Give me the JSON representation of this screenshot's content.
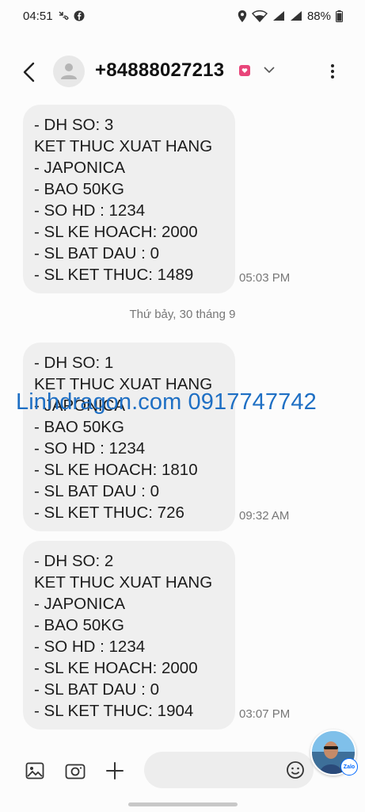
{
  "status_bar": {
    "time": "04:51",
    "battery": "88%"
  },
  "header": {
    "contact": "+84888027213"
  },
  "messages": [
    {
      "lines": [
        "- DH SO: 3",
        "KET THUC XUAT HANG",
        "- JAPONICA",
        "- BAO 50KG",
        "- SO HD : 1234",
        "- SL KE HOACH: 2000",
        "- SL BAT DAU : 0",
        "- SL KET THUC: 1489"
      ],
      "time": "05:03 PM"
    },
    {
      "lines": [
        "- DH SO: 1",
        "KET THUC XUAT HANG",
        "- JAPONICA",
        "- BAO 50KG",
        "- SO HD : 1234",
        "- SL KE HOACH: 1810",
        "- SL BAT DAU : 0",
        "- SL KET THUC: 726"
      ],
      "time": "09:32 AM"
    },
    {
      "lines": [
        "- DH SO: 2",
        "KET THUC XUAT HANG",
        "- JAPONICA",
        "- BAO 50KG",
        "- SO HD : 1234",
        "- SL KE HOACH: 2000",
        "- SL BAT DAU : 0",
        "- SL KET THUC: 1904"
      ],
      "time": "03:07 PM"
    }
  ],
  "date_separator": "Thứ bảy, 30 tháng 9",
  "watermark": "Linhdragon.com 0917747742",
  "input": {
    "placeholder": ""
  },
  "zalo_badge": "Zalo",
  "icons": {
    "status": [
      "missed-call-icon",
      "facebook-icon",
      "location-icon",
      "wifi-icon",
      "signal-icon",
      "battery-icon"
    ],
    "header": [
      "back-arrow-icon",
      "person-icon",
      "sim-icon",
      "chevron-down-icon",
      "more-vert-icon"
    ],
    "input_bar": [
      "gallery-icon",
      "camera-icon",
      "plus-icon",
      "emoji-icon"
    ]
  }
}
